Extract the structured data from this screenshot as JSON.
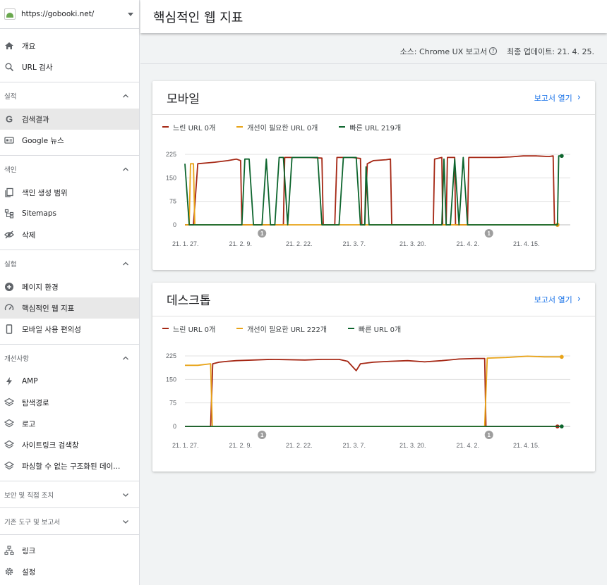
{
  "property_url": "https://gobooki.net/",
  "page_title": "핵심적인 웹 지표",
  "source_text": "소스: Chrome UX 보고서",
  "updated_text": "최종 업데이트: 21. 4. 25.",
  "colors": {
    "slow": "#a52714",
    "improve": "#e8a317",
    "fast": "#0d652d",
    "link": "#1a73e8"
  },
  "nav": {
    "top": [
      {
        "label": "개요",
        "icon": "home-icon"
      },
      {
        "label": "URL 검사",
        "icon": "search-icon"
      }
    ],
    "sections": [
      {
        "title": "실적",
        "items": [
          {
            "label": "검색결과",
            "icon": "google-g-icon"
          },
          {
            "label": "Google 뉴스",
            "icon": "news-icon"
          }
        ]
      },
      {
        "title": "색인",
        "items": [
          {
            "label": "색인 생성 범위",
            "icon": "coverage-icon"
          },
          {
            "label": "Sitemaps",
            "icon": "sitemap-icon"
          },
          {
            "label": "삭제",
            "icon": "eye-off-icon"
          }
        ]
      },
      {
        "title": "실험",
        "items": [
          {
            "label": "페이지 환경",
            "icon": "plus-circle-icon"
          },
          {
            "label": "핵심적인 웹 지표",
            "icon": "gauge-icon"
          },
          {
            "label": "모바일 사용 편의성",
            "icon": "phone-icon"
          }
        ]
      },
      {
        "title": "개선사항",
        "items": [
          {
            "label": "AMP",
            "icon": "bolt-icon"
          },
          {
            "label": "탐색경로",
            "icon": "layers-icon"
          },
          {
            "label": "로고",
            "icon": "layers-icon"
          },
          {
            "label": "사이트링크 검색창",
            "icon": "layers-icon"
          },
          {
            "label": "파싱할 수 없는 구조화된 데이...",
            "icon": "layers-icon"
          }
        ]
      },
      {
        "title": "보안 및 직접 조치",
        "items": []
      },
      {
        "title": "기존 도구 및 보고서",
        "items": []
      }
    ],
    "bottom": [
      {
        "label": "링크",
        "icon": "links-icon"
      },
      {
        "label": "설정",
        "icon": "settings-icon"
      }
    ]
  },
  "cards": [
    {
      "title": "모바일",
      "open_label": "보고서 열기",
      "legend": [
        "느린 URL 0개",
        "개선이 필요한 URL 0개",
        "빠른 URL 219개"
      ]
    },
    {
      "title": "데스크톱",
      "open_label": "보고서 열기",
      "legend": [
        "느린 URL 0개",
        "개선이 필요한 URL 222개",
        "빠른 URL 0개"
      ]
    }
  ],
  "chart_data": [
    {
      "type": "line",
      "title": "모바일",
      "ylim": [
        0,
        225
      ],
      "yticks": [
        0,
        75,
        150,
        225
      ],
      "xticklabels": [
        "21. 1. 27.",
        "21. 2. 9.",
        "21. 2. 22.",
        "21. 3. 7.",
        "21. 3. 20.",
        "21. 4. 2.",
        "21. 4. 15."
      ],
      "xrange": [
        0,
        90
      ],
      "markers": [
        {
          "x": 18,
          "label": "1"
        },
        {
          "x": 71,
          "label": "1"
        }
      ],
      "series": [
        {
          "name": "느린 URL",
          "color": "#a52714",
          "points": [
            [
              0,
              0
            ],
            [
              2,
              0
            ],
            [
              3,
              195
            ],
            [
              7,
              200
            ],
            [
              10,
              205
            ],
            [
              12,
              210
            ],
            [
              13,
              205
            ],
            [
              13.3,
              0
            ],
            [
              22,
              0
            ],
            [
              23,
              0
            ],
            [
              23.3,
              215
            ],
            [
              26,
              215
            ],
            [
              29,
              215
            ],
            [
              32,
              213
            ],
            [
              32.3,
              0
            ],
            [
              35,
              0
            ],
            [
              35.5,
              215
            ],
            [
              39,
              215
            ],
            [
              41,
              212
            ],
            [
              41.3,
              0
            ],
            [
              42,
              0
            ],
            [
              42.6,
              195
            ],
            [
              44,
              205
            ],
            [
              47,
              208
            ],
            [
              48,
              210
            ],
            [
              48.3,
              0
            ],
            [
              53,
              0
            ],
            [
              57,
              0
            ],
            [
              58,
              0
            ],
            [
              58.3,
              210
            ],
            [
              60,
              215
            ],
            [
              60.2,
              0
            ],
            [
              61,
              0
            ],
            [
              61.3,
              215
            ],
            [
              63,
              215
            ],
            [
              63.2,
              0
            ],
            [
              66,
              0
            ],
            [
              66.3,
              215
            ],
            [
              70,
              215
            ],
            [
              73,
              215
            ],
            [
              76,
              217
            ],
            [
              79,
              220
            ],
            [
              82,
              220
            ],
            [
              85,
              218
            ],
            [
              86,
              220
            ],
            [
              86.3,
              0
            ],
            [
              87,
              0
            ]
          ]
        },
        {
          "name": "개선이 필요한 URL",
          "color": "#e8a317",
          "points": [
            [
              0,
              0
            ],
            [
              1,
              0
            ],
            [
              1.3,
              195
            ],
            [
              2,
              195
            ],
            [
              2.3,
              0
            ],
            [
              87,
              0
            ]
          ]
        },
        {
          "name": "빠른 URL",
          "color": "#0d652d",
          "points": [
            [
              0,
              195
            ],
            [
              1,
              0
            ],
            [
              3,
              0
            ],
            [
              7,
              0
            ],
            [
              8,
              0
            ],
            [
              9,
              0
            ],
            [
              11,
              0
            ],
            [
              12,
              0
            ],
            [
              13,
              0
            ],
            [
              13.3,
              0
            ],
            [
              14,
              210
            ],
            [
              15,
              210
            ],
            [
              16,
              0
            ],
            [
              17,
              0
            ],
            [
              18,
              0
            ],
            [
              19,
              210
            ],
            [
              20,
              0
            ],
            [
              21,
              0
            ],
            [
              22,
              215
            ],
            [
              23,
              215
            ],
            [
              24,
              0
            ],
            [
              25,
              215
            ],
            [
              31,
              215
            ],
            [
              32,
              0
            ],
            [
              35,
              0
            ],
            [
              36,
              0
            ],
            [
              37,
              215
            ],
            [
              40,
              215
            ],
            [
              41,
              0
            ],
            [
              42,
              0
            ],
            [
              42.3,
              185
            ],
            [
              43,
              0
            ],
            [
              48.3,
              0
            ],
            [
              53,
              0
            ],
            [
              58,
              0
            ],
            [
              60,
              0
            ],
            [
              60.5,
              210
            ],
            [
              61,
              0
            ],
            [
              62,
              0
            ],
            [
              63,
              210
            ],
            [
              64,
              0
            ],
            [
              65,
              215
            ],
            [
              66,
              0
            ],
            [
              66.3,
              0
            ],
            [
              69,
              0
            ],
            [
              87,
              0
            ],
            [
              87.3,
              220
            ],
            [
              88,
              220
            ]
          ]
        }
      ]
    },
    {
      "type": "line",
      "title": "데스크톱",
      "ylim": [
        0,
        225
      ],
      "yticks": [
        0,
        75,
        150,
        225
      ],
      "xticklabels": [
        "21. 1. 27.",
        "21. 2. 9.",
        "21. 2. 22.",
        "21. 3. 7.",
        "21. 3. 20.",
        "21. 4. 2.",
        "21. 4. 15."
      ],
      "xrange": [
        0,
        90
      ],
      "markers": [
        {
          "x": 18,
          "label": "1"
        },
        {
          "x": 71,
          "label": "1"
        }
      ],
      "series": [
        {
          "name": "느린 URL",
          "color": "#a52714",
          "points": [
            [
              0,
              0
            ],
            [
              6,
              0
            ],
            [
              6.5,
              200
            ],
            [
              8,
              205
            ],
            [
              10,
              208
            ],
            [
              12,
              210
            ],
            [
              16,
              212
            ],
            [
              20,
              214
            ],
            [
              24,
              213
            ],
            [
              28,
              212
            ],
            [
              32,
              214
            ],
            [
              36,
              214
            ],
            [
              38,
              208
            ],
            [
              40,
              178
            ],
            [
              41,
              200
            ],
            [
              44,
              205
            ],
            [
              48,
              208
            ],
            [
              52,
              210
            ],
            [
              56,
              206
            ],
            [
              60,
              210
            ],
            [
              64,
              215
            ],
            [
              68,
              217
            ],
            [
              70,
              217
            ],
            [
              70.3,
              0
            ],
            [
              87,
              0
            ]
          ]
        },
        {
          "name": "개선이 필요한 URL",
          "color": "#e8a317",
          "points": [
            [
              0,
              195
            ],
            [
              3,
              195
            ],
            [
              6,
              200
            ],
            [
              6.4,
              0
            ],
            [
              70,
              0
            ],
            [
              70.6,
              218
            ],
            [
              75,
              220
            ],
            [
              80,
              224
            ],
            [
              84,
              222
            ],
            [
              88,
              222
            ]
          ]
        },
        {
          "name": "빠른 URL",
          "color": "#0d652d",
          "points": [
            [
              0,
              0
            ],
            [
              88,
              0
            ]
          ]
        }
      ]
    }
  ]
}
